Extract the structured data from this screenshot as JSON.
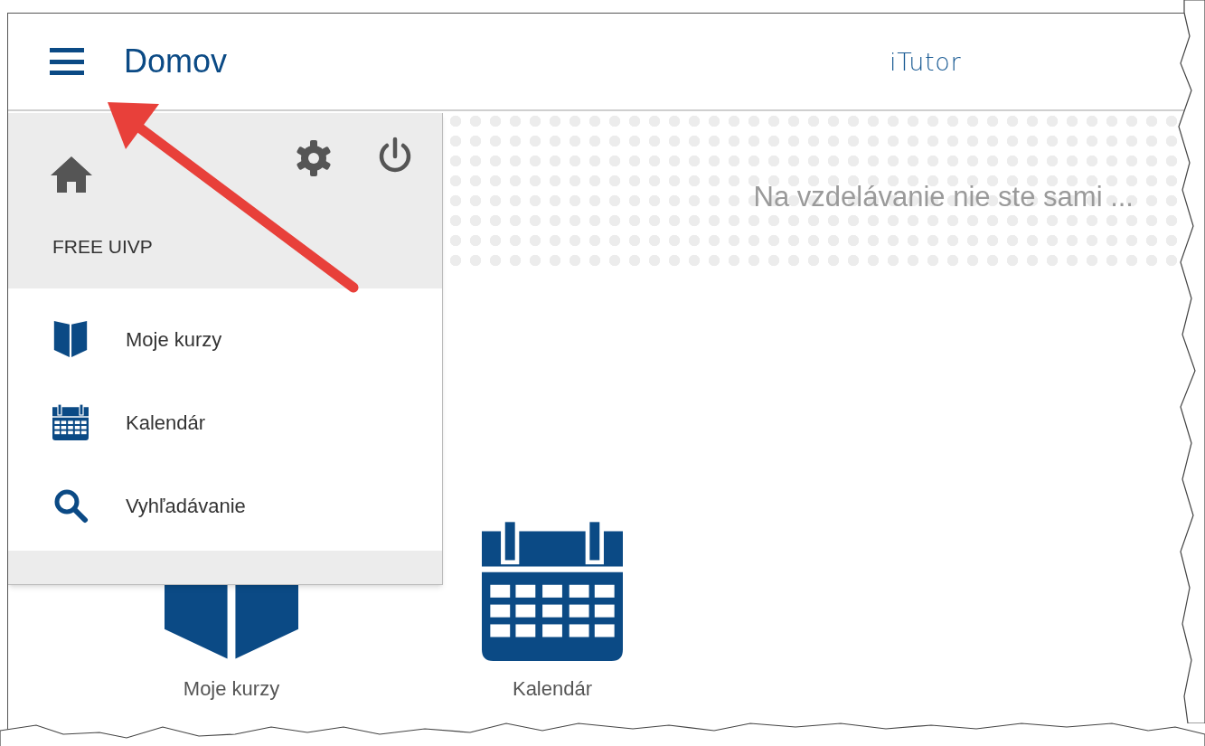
{
  "header": {
    "title": "Domov",
    "brand": "iTutor"
  },
  "drawer": {
    "account": "FREE UIVP",
    "items": [
      {
        "kind": "book",
        "label": "Moje kurzy"
      },
      {
        "kind": "calendar",
        "label": "Kalendár"
      },
      {
        "kind": "search",
        "label": "Vyhľadávanie"
      }
    ]
  },
  "banner": {
    "tagline": "Na vzdelávanie nie ste sami ..."
  },
  "tiles": [
    {
      "kind": "book",
      "label": "Moje kurzy"
    },
    {
      "kind": "calendar",
      "label": "Kalendár"
    }
  ]
}
